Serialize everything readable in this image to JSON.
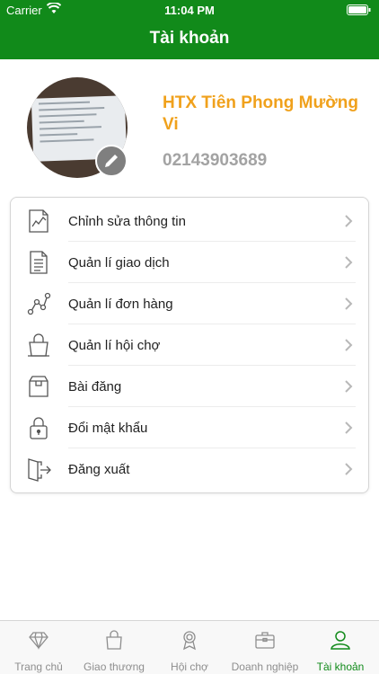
{
  "status_bar": {
    "carrier": "Carrier",
    "time": "11:04 PM"
  },
  "header": {
    "title": "Tài khoản"
  },
  "profile": {
    "name": "HTX Tiên Phong Mường Vi",
    "phone": "02143903689"
  },
  "menu": [
    {
      "label": "Chỉnh sửa thông tin",
      "icon": "chart-document-icon"
    },
    {
      "label": "Quản lí giao dịch",
      "icon": "document-list-icon"
    },
    {
      "label": "Quản lí đơn hàng",
      "icon": "route-nodes-icon"
    },
    {
      "label": "Quản lí hội chợ",
      "icon": "shopping-bag-icon"
    },
    {
      "label": "Bài đăng",
      "icon": "box-icon"
    },
    {
      "label": "Đổi mật khẩu",
      "icon": "lock-icon"
    },
    {
      "label": "Đăng xuất",
      "icon": "logout-icon"
    }
  ],
  "tabs": [
    {
      "label": "Trang chủ",
      "icon": "diamond-icon"
    },
    {
      "label": "Giao thương",
      "icon": "shopping-bag-icon"
    },
    {
      "label": "Hội chợ",
      "icon": "award-icon"
    },
    {
      "label": "Doanh nghiệp",
      "icon": "briefcase-icon"
    },
    {
      "label": "Tài khoản",
      "icon": "user-icon",
      "active": true
    }
  ],
  "colors": {
    "primary": "#118a1a",
    "name_accent": "#f0a11c",
    "phone": "#a3a3a3"
  }
}
